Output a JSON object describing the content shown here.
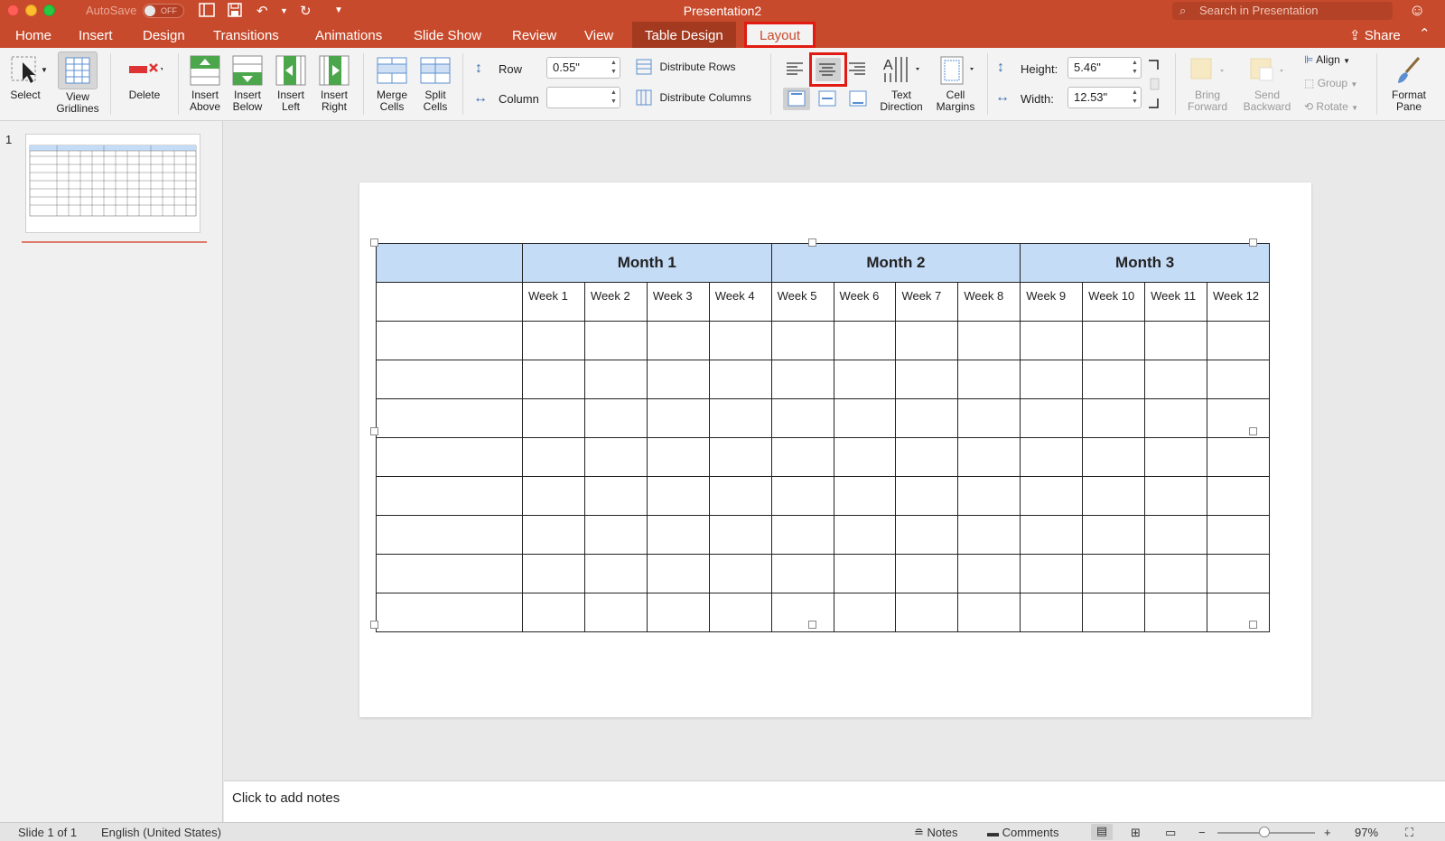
{
  "window": {
    "title": "Presentation2",
    "autosave_label": "AutoSave",
    "autosave_state": "OFF",
    "search_placeholder": "Search in Presentation"
  },
  "tabs": [
    "Home",
    "Insert",
    "Design",
    "Transitions",
    "Animations",
    "Slide Show",
    "Review",
    "View",
    "Table Design",
    "Layout"
  ],
  "active_tab": "Layout",
  "share_label": "Share",
  "ribbon": {
    "select": "Select",
    "view_gridlines_1": "View",
    "view_gridlines_2": "Gridlines",
    "delete": "Delete",
    "insert_above_1": "Insert",
    "insert_above_2": "Above",
    "insert_below_1": "Insert",
    "insert_below_2": "Below",
    "insert_left_1": "Insert",
    "insert_left_2": "Left",
    "insert_right_1": "Insert",
    "insert_right_2": "Right",
    "merge_cells_1": "Merge",
    "merge_cells_2": "Cells",
    "split_cells_1": "Split",
    "split_cells_2": "Cells",
    "row_label": "Row",
    "row_value": "0.55\"",
    "column_label": "Column",
    "column_value": "",
    "distribute_rows": "Distribute Rows",
    "distribute_columns": "Distribute Columns",
    "text_direction_1": "Text",
    "text_direction_2": "Direction",
    "cell_margins_1": "Cell",
    "cell_margins_2": "Margins",
    "height_label": "Height:",
    "height_value": "5.46\"",
    "width_label": "Width:",
    "width_value": "12.53\"",
    "bring_forward_1": "Bring",
    "bring_forward_2": "Forward",
    "send_backward_1": "Send",
    "send_backward_2": "Backward",
    "align": "Align",
    "group": "Group",
    "rotate": "Rotate",
    "format_pane_1": "Format",
    "format_pane_2": "Pane"
  },
  "slide_panel": {
    "slide_number": "1"
  },
  "table": {
    "months": [
      "Month 1",
      "Month 2",
      "Month 3"
    ],
    "weeks": [
      "Week 1",
      "Week 2",
      "Week 3",
      "Week 4",
      "Week 5",
      "Week 6",
      "Week 7",
      "Week 8",
      "Week 9",
      "Week 10",
      "Week 11",
      "Week 12"
    ],
    "empty_body_rows": 8
  },
  "notes_placeholder": "Click to add notes",
  "status": {
    "slide_info": "Slide 1 of 1",
    "language": "English (United States)",
    "notes": "Notes",
    "comments": "Comments",
    "zoom": "97%"
  },
  "colors": {
    "ribbon_accent": "#c84a2c",
    "highlight_box": "#e11b12",
    "table_header": "#c5dcf7"
  }
}
